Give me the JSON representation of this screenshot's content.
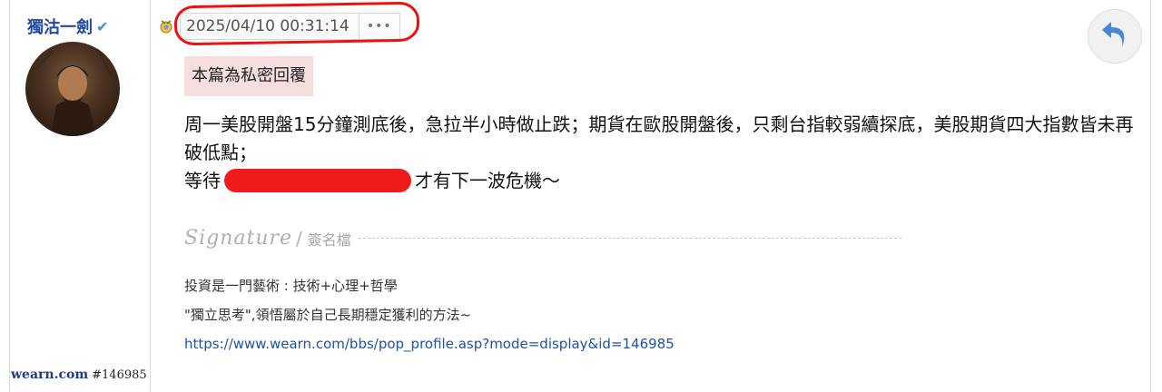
{
  "user": {
    "name": "獨沽一劍",
    "verified_mark": "✔"
  },
  "site": {
    "brand": "wearn.com",
    "id_label": "#146985"
  },
  "post": {
    "timestamp": "2025/04/10 00:31:14",
    "more_label": "•••",
    "private_tag": "本篇為私密回覆",
    "line1": "周一美股開盤15分鐘測底後，急拉半小時做止跌；期貨在歐股開盤後，只剩台指較弱續探底，美股期貨四大指數皆未再破低點；",
    "line3_prefix": "等待",
    "line3_suffix": "才有下一波危機～"
  },
  "signature": {
    "script_label": "Signature",
    "separator": "/",
    "label": "簽名檔",
    "line1": "投資是一門藝術 : 技術+心理+哲學",
    "line2": "\"獨立思考\",領悟屬於自己長期穩定獲利的方法~",
    "link": "https://www.wearn.com/bbs/pop_profile.asp?mode=display&id=146985"
  },
  "icons": {
    "meta": "medal-icon",
    "reply": "reply-arrow-icon"
  },
  "colors": {
    "username": "#1f4aa0",
    "private_tag_bg": "#f7dede",
    "highlight": "#ee1111",
    "redaction": "#f01b1b",
    "link": "#1f52a8"
  }
}
